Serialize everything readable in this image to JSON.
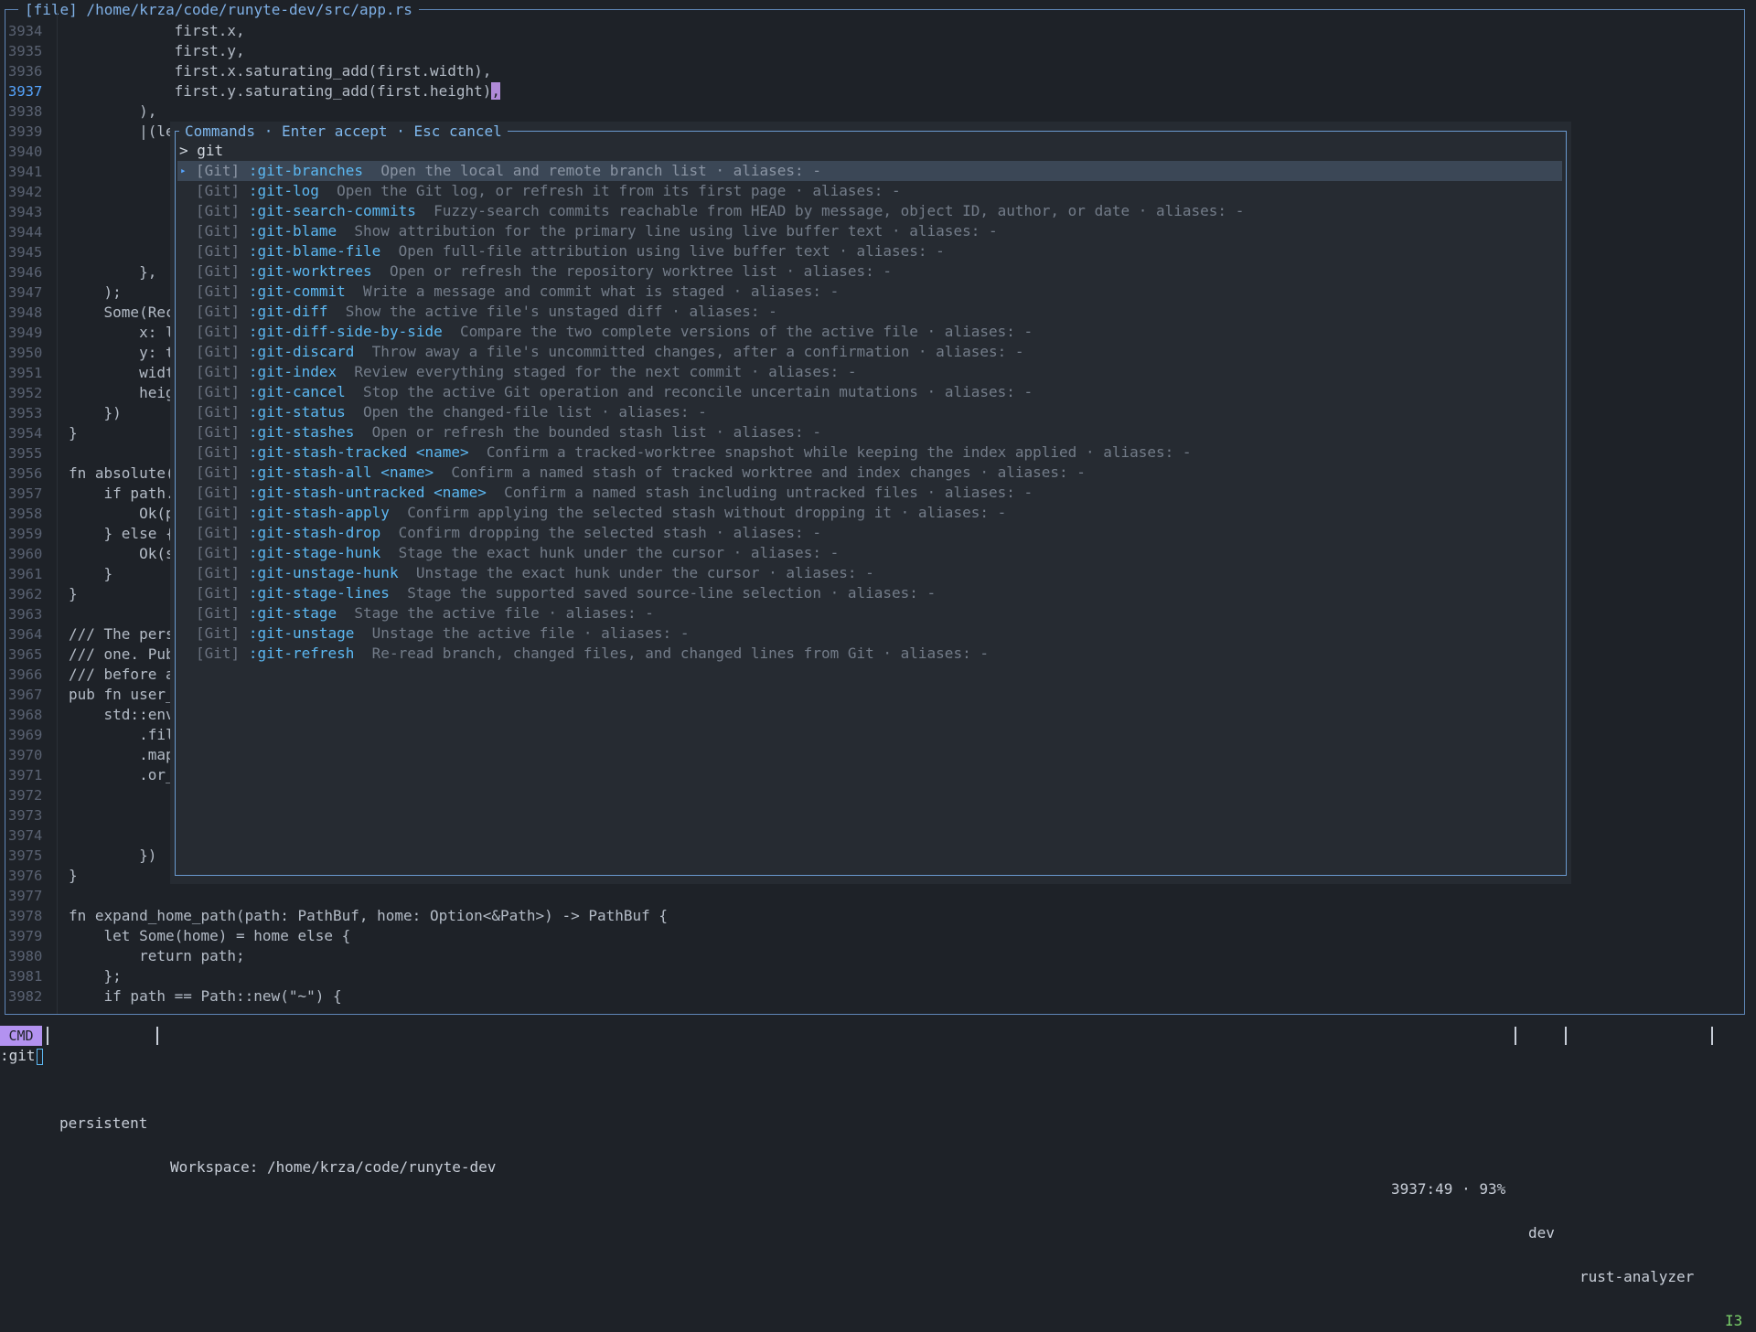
{
  "editor": {
    "title": "[file] /home/krza/code/runyte-dev/src/app.rs",
    "current_line": "3937",
    "lines": [
      {
        "n": "3934",
        "code": "            first.x,"
      },
      {
        "n": "3935",
        "code": "            first.y,"
      },
      {
        "n": "3936",
        "code": "            first.x.saturating_add(first.width),"
      },
      {
        "n": "3937",
        "code": "            first.y.saturating_add(first.height)"
      },
      {
        "n": "3938",
        "code": "        ),"
      },
      {
        "n": "3939",
        "code": "        |(le"
      },
      {
        "n": "3940",
        "code": ""
      },
      {
        "n": "3941",
        "code": ""
      },
      {
        "n": "3942",
        "code": ""
      },
      {
        "n": "3943",
        "code": ""
      },
      {
        "n": "3944",
        "code": ""
      },
      {
        "n": "3945",
        "code": ""
      },
      {
        "n": "3946",
        "code": "        },"
      },
      {
        "n": "3947",
        "code": "    );"
      },
      {
        "n": "3948",
        "code": "    Some(Rec"
      },
      {
        "n": "3949",
        "code": "        x: l"
      },
      {
        "n": "3950",
        "code": "        y: t"
      },
      {
        "n": "3951",
        "code": "        widt"
      },
      {
        "n": "3952",
        "code": "        heig"
      },
      {
        "n": "3953",
        "code": "    })"
      },
      {
        "n": "3954",
        "code": "}"
      },
      {
        "n": "3955",
        "code": ""
      },
      {
        "n": "3956",
        "code": "fn absolute("
      },
      {
        "n": "3957",
        "code": "    if path."
      },
      {
        "n": "3958",
        "code": "        Ok(p"
      },
      {
        "n": "3959",
        "code": "    } else {"
      },
      {
        "n": "3960",
        "code": "        Ok(s"
      },
      {
        "n": "3961",
        "code": "    }"
      },
      {
        "n": "3962",
        "code": "}"
      },
      {
        "n": "3963",
        "code": ""
      },
      {
        "n": "3964",
        "code": "/// The pers"
      },
      {
        "n": "3965",
        "code": "/// one. Pub"
      },
      {
        "n": "3966",
        "code": "/// before a"
      },
      {
        "n": "3967",
        "code": "pub fn user_"
      },
      {
        "n": "3968",
        "code": "    std::env"
      },
      {
        "n": "3969",
        "code": "        .fil"
      },
      {
        "n": "3970",
        "code": "        .map"
      },
      {
        "n": "3971",
        "code": "        .or_"
      },
      {
        "n": "3972",
        "code": ""
      },
      {
        "n": "3973",
        "code": ""
      },
      {
        "n": "3974",
        "code": ""
      },
      {
        "n": "3975",
        "code": "        })"
      },
      {
        "n": "3976",
        "code": "}"
      },
      {
        "n": "3977",
        "code": ""
      },
      {
        "n": "3978",
        "code": "fn expand_home_path(path: PathBuf, home: Option<&Path>) -> PathBuf {"
      },
      {
        "n": "3979",
        "code": "    let Some(home) = home else {"
      },
      {
        "n": "3980",
        "code": "        return path;"
      },
      {
        "n": "3981",
        "code": "    };"
      },
      {
        "n": "3982",
        "code": "    if path == Path::new(\"~\") {"
      }
    ],
    "cursor_char": ","
  },
  "palette": {
    "title": "Commands · Enter accept · Esc cancel",
    "query_prompt": ">",
    "query": "git",
    "selected_index": 0,
    "results": [
      {
        "category": "[Git]",
        "command": ":git-branches",
        "description": "Open the local and remote branch list · aliases: -"
      },
      {
        "category": "[Git]",
        "command": ":git-log",
        "description": "Open the Git log, or refresh it from its first page · aliases: -"
      },
      {
        "category": "[Git]",
        "command": ":git-search-commits",
        "description": "Fuzzy-search commits reachable from HEAD by message, object ID, author, or date · aliases: -"
      },
      {
        "category": "[Git]",
        "command": ":git-blame",
        "description": "Show attribution for the primary line using live buffer text · aliases: -"
      },
      {
        "category": "[Git]",
        "command": ":git-blame-file",
        "description": "Open full-file attribution using live buffer text · aliases: -"
      },
      {
        "category": "[Git]",
        "command": ":git-worktrees",
        "description": "Open or refresh the repository worktree list · aliases: -"
      },
      {
        "category": "[Git]",
        "command": ":git-commit",
        "description": "Write a message and commit what is staged · aliases: -"
      },
      {
        "category": "[Git]",
        "command": ":git-diff",
        "description": "Show the active file's unstaged diff · aliases: -"
      },
      {
        "category": "[Git]",
        "command": ":git-diff-side-by-side",
        "description": "Compare the two complete versions of the active file · aliases: -"
      },
      {
        "category": "[Git]",
        "command": ":git-discard",
        "description": "Throw away a file's uncommitted changes, after a confirmation · aliases: -"
      },
      {
        "category": "[Git]",
        "command": ":git-index",
        "description": "Review everything staged for the next commit · aliases: -"
      },
      {
        "category": "[Git]",
        "command": ":git-cancel",
        "description": "Stop the active Git operation and reconcile uncertain mutations · aliases: -"
      },
      {
        "category": "[Git]",
        "command": ":git-status",
        "description": "Open the changed-file list · aliases: -"
      },
      {
        "category": "[Git]",
        "command": ":git-stashes",
        "description": "Open or refresh the bounded stash list · aliases: -"
      },
      {
        "category": "[Git]",
        "command": ":git-stash-tracked <name>",
        "description": "Confirm a tracked-worktree snapshot while keeping the index applied · aliases: -"
      },
      {
        "category": "[Git]",
        "command": ":git-stash-all <name>",
        "description": "Confirm a named stash of tracked worktree and index changes · aliases: -"
      },
      {
        "category": "[Git]",
        "command": ":git-stash-untracked <name>",
        "description": "Confirm a named stash including untracked files · aliases: -"
      },
      {
        "category": "[Git]",
        "command": ":git-stash-apply",
        "description": "Confirm applying the selected stash without dropping it · aliases: -"
      },
      {
        "category": "[Git]",
        "command": ":git-stash-drop",
        "description": "Confirm dropping the selected stash · aliases: -"
      },
      {
        "category": "[Git]",
        "command": ":git-stage-hunk",
        "description": "Stage the exact hunk under the cursor · aliases: -"
      },
      {
        "category": "[Git]",
        "command": ":git-unstage-hunk",
        "description": "Unstage the exact hunk under the cursor · aliases: -"
      },
      {
        "category": "[Git]",
        "command": ":git-stage-lines",
        "description": "Stage the supported saved source-line selection · aliases: -"
      },
      {
        "category": "[Git]",
        "command": ":git-stage",
        "description": "Stage the active file · aliases: -"
      },
      {
        "category": "[Git]",
        "command": ":git-unstage",
        "description": "Unstage the active file · aliases: -"
      },
      {
        "category": "[Git]",
        "command": ":git-refresh",
        "description": "Re-read branch, changed files, and changed lines from Git · aliases: -"
      }
    ]
  },
  "status": {
    "mode": "CMD",
    "session": "persistent",
    "workspace": "Workspace: /home/krza/code/runyte-dev",
    "position": "3937:49 · 93%",
    "branch": "dev",
    "lsp": "rust-analyzer",
    "badge": "I3"
  },
  "cmdline": {
    "text": ":git"
  },
  "colors": {
    "background": "#1e2228",
    "accent": "#5cb8f2",
    "mode_badge": "#b392f0",
    "selection": "#3b4756"
  }
}
